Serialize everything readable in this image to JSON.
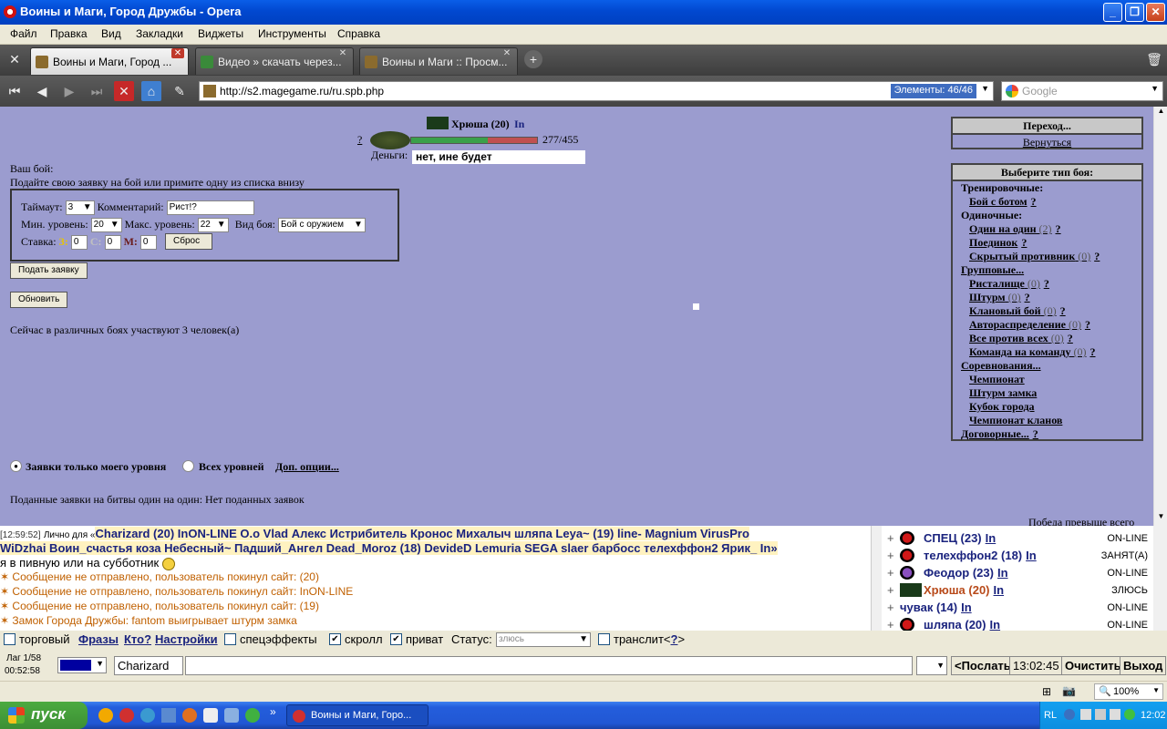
{
  "window": {
    "title": "Воины и Маги, Город Дружбы - Opera"
  },
  "menu": [
    "Файл",
    "Правка",
    "Вид",
    "Закладки",
    "Виджеты",
    "Инструменты",
    "Справка"
  ],
  "tabs": [
    {
      "label": "Воины и Маги, Город ...",
      "active": true
    },
    {
      "label": "Видео » скачать через...",
      "active": false
    },
    {
      "label": "Воины и Маги :: Просм...",
      "active": false
    }
  ],
  "address": {
    "url": "http://s2.magegame.ru/ru.spb.php",
    "elements": "Элементы:  46/46",
    "search_placeholder": "Google"
  },
  "player": {
    "name": "Хрюша (20)",
    "online_link": "In",
    "question": "?",
    "hp": "277/455",
    "money_label": "Деньги:",
    "tooltip": "нет, ине будет"
  },
  "battle": {
    "your_fight": "Ваш бой:",
    "instruction": "Подайте свою заявку на бой или примите одну из списка внизу",
    "timeout_label": "Таймаут:",
    "timeout_value": "3",
    "comment_label": "Комментарий:",
    "comment_value": "Рист!?",
    "min_level_label": "Мин. уровень:",
    "min_level_value": "20",
    "max_level_label": "Макс. уровень:",
    "max_level_value": "22",
    "fight_type_label": "Вид боя:",
    "fight_type_value": "Бой с оружием",
    "stake_label": "Ставка:",
    "stake_z": "З:",
    "stake_z_value": "0",
    "stake_s": "С:",
    "stake_s_value": "0",
    "stake_m": "М:",
    "stake_m_value": "0",
    "reset_button": "Сброс",
    "submit_button": "Подать заявку",
    "refresh_button": "Обновить",
    "participants_text": "Сейчас в различных боях участвуют 3 человек(а)",
    "radio_my_level": "Заявки только моего уровня",
    "radio_all_levels": "Всех уровней",
    "extra_options": "Доп. опции...",
    "applications_text": "Поданные заявки на битвы один на один: Нет поданных заявок",
    "victory_text": "Победа превыше всего"
  },
  "transition_box": {
    "header": "Переход...",
    "link": "Вернуться"
  },
  "fight_types": {
    "header": "Выберите тип боя:",
    "training": "Тренировочные:",
    "bot": "Бой с ботом",
    "single": "Одиночные:",
    "one_on_one": "Один на один",
    "one_on_one_count": "(2)",
    "duel": "Поединок",
    "hidden": "Скрытый противник",
    "hidden_count": "(0)",
    "group": "Групповые...",
    "arena": "Ристалище",
    "arena_count": "(0)",
    "assault": "Штурм",
    "assault_count": "(0)",
    "clan": "Клановый бой",
    "clan_count": "(0)",
    "auto": "Автораспределение",
    "auto_count": "(0)",
    "all_vs_all": "Все против всех",
    "all_vs_all_count": "(0)",
    "team": "Команда на команду",
    "team_count": "(0)",
    "competitions": "Соревнования...",
    "championship": "Чемпионат",
    "castle": "Штурм замка",
    "cup": "Кубок города",
    "clan_champ": "Чемпионат кланов",
    "contracts": "Договорные...",
    "q": "?"
  },
  "chat": {
    "line1_time": "[12:59:52]",
    "line1_private": "Лично для «",
    "line1_names": "Charizard (20) InON-LINE O.o Vlad Алекс Истрибитель Кронос Михалыч шляпа Leya~ (19) line- Magnium VirusPro",
    "line2_names": "WiDzhai Воин_счастья коза Небесный~ Падший_Ангел Dead_Moroz (18) DevideD Lemuria SEGA slaer барбосс телехффон2 Ярик_ In»",
    "line3": "я в пивную или на субботник",
    "msg1": "Сообщение не отправлено, пользователь покинул сайт: (20)",
    "msg2": "Сообщение не отправлено, пользователь покинул сайт: InON-LINE",
    "msg3": "Сообщение не отправлено, пользователь покинул сайт: (19)",
    "msg4": "Замок Города Дружбы: fantom выигрывает штурм замка"
  },
  "users": [
    {
      "name": "СПЕЦ (23)",
      "in": "In",
      "status": "ON-LINE"
    },
    {
      "name": "телехффон2 (18)",
      "in": "In",
      "status": "ЗАНЯТ(А)"
    },
    {
      "name": "Феодор (23)",
      "in": "In",
      "status": "ON-LINE"
    },
    {
      "name": "Хрюша (20)",
      "in": "In",
      "status": "ЗЛЮСЬ"
    },
    {
      "name": "чувак (14)",
      "in": "In",
      "status": "ON-LINE"
    },
    {
      "name": "шляпа (20)",
      "in": "In",
      "status": "ON-LINE"
    }
  ],
  "chat_options": {
    "trade": "торговый",
    "phrases": "Фразы",
    "who": "Кто?",
    "settings": "Настройки",
    "effects": "спецэффекты",
    "scroll": "скролл",
    "private": "приват",
    "status_label": "Статус:",
    "status_value": "злюсь",
    "translit": "транслит<",
    "translit_q": "?",
    "translit_end": ">"
  },
  "chat_input": {
    "lag": "Лаг 1/58",
    "time": "00:52:58",
    "recipient": "Charizard",
    "send": "<Послать",
    "clock": "13:02:45",
    "clear": "Очистить",
    "exit": "Выход"
  },
  "statusbar": {
    "zoom": "100%"
  },
  "taskbar": {
    "start": "пуск",
    "task": "Воины и Маги, Горо...",
    "lang": "RL",
    "clock": "12:02"
  }
}
